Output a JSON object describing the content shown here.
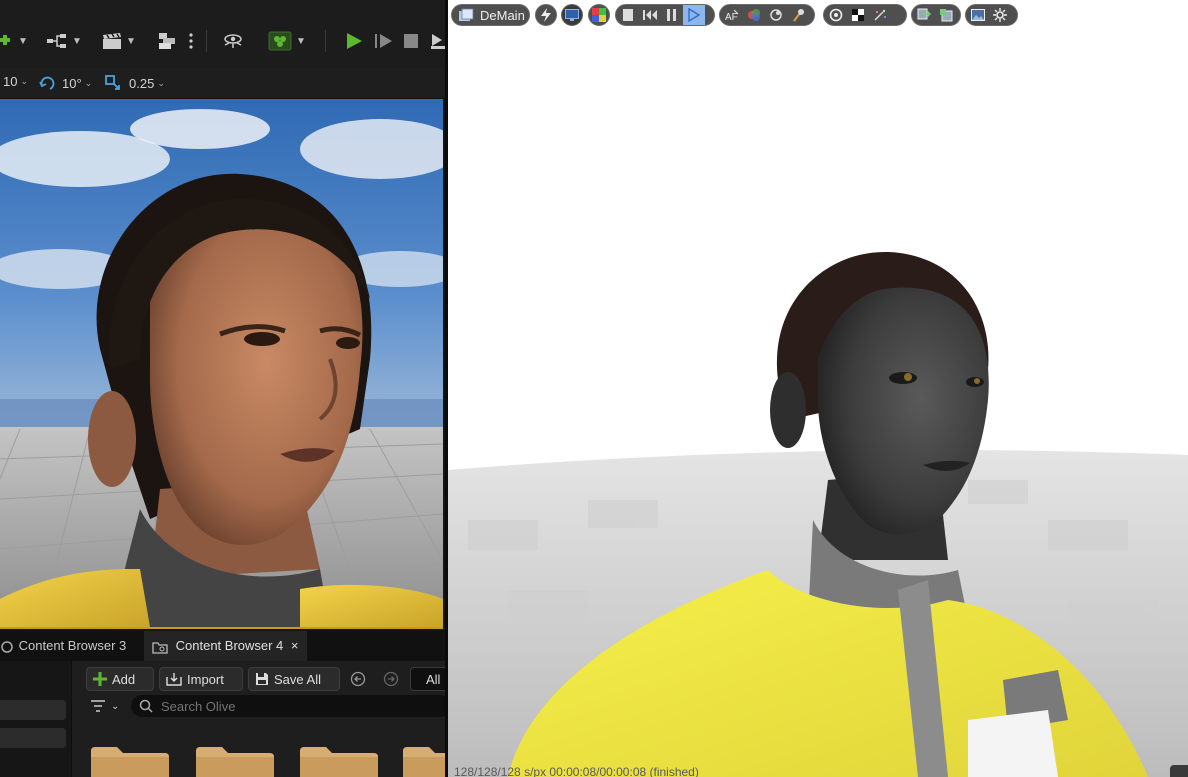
{
  "editor": {
    "snap": {
      "grid_value": "10",
      "rotation_value": "10°",
      "scale_value": "0.25"
    },
    "content_browser": {
      "tabs": [
        {
          "label": "Content Browser 3"
        },
        {
          "label": "Content Browser 4",
          "close": "×"
        }
      ],
      "buttons": {
        "add": "Add",
        "import": "Import",
        "save_all": "Save All",
        "filter_all": "All"
      },
      "search_placeholder": "Search Olive"
    }
  },
  "render_window": {
    "title": "DeMain",
    "status_text": "128/128/128 s/px  00:00:08/00:00:08  (finished)"
  },
  "colors": {
    "accent_yellow": "#c99a16",
    "play_green": "#5cb82e",
    "selected_blue": "#8db7ea",
    "folder": "#d6ae72"
  }
}
